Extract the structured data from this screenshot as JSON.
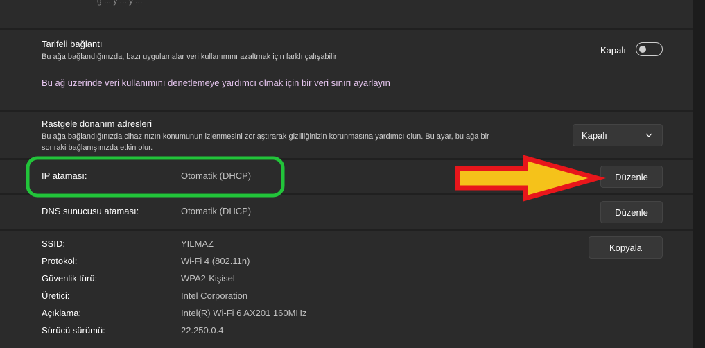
{
  "top_partial": {
    "text": "g ... y ... y ..."
  },
  "metered": {
    "title": "Tarifeli bağlantı",
    "description": "Bu ağa bağlandığınızda, bazı uygulamalar veri kullanımını azaltmak için farklı çalışabilir",
    "toggle_label": "Kapalı",
    "toggle_state": "off",
    "link": "Bu ağ üzerinde veri kullanımını denetlemeye yardımcı olmak için bir veri sınırı ayarlayın"
  },
  "random_hw": {
    "title": "Rastgele donanım adresleri",
    "description_line1": "Bu ağa bağlandığınızda cihazınızın konumunun izlenmesini zorlaştırarak gizliliğinizin korunmasına yardımcı olun. Bu ayar, bu ağa bir",
    "description_line2": "sonraki bağlanışınızda etkin olur.",
    "dropdown_value": "Kapalı"
  },
  "ip": {
    "label": "IP ataması:",
    "value": "Otomatik (DHCP)",
    "button": "Düzenle"
  },
  "dns": {
    "label": "DNS sunucusu ataması:",
    "value": "Otomatik (DHCP)",
    "button": "Düzenle"
  },
  "properties": {
    "copy_button": "Kopyala",
    "rows": [
      {
        "label": "SSID:",
        "value": "YILMAZ"
      },
      {
        "label": "Protokol:",
        "value": "Wi-Fi 4 (802.11n)"
      },
      {
        "label": "Güvenlik türü:",
        "value": "WPA2-Kişisel"
      },
      {
        "label": "Üretici:",
        "value": "Intel Corporation"
      },
      {
        "label": "Açıklama:",
        "value": "Intel(R) Wi-Fi 6 AX201 160MHz"
      },
      {
        "label": "Sürücü sürümü:",
        "value": "22.250.0.4"
      }
    ]
  },
  "annotations": {
    "highlight_color": "#22c43a",
    "arrow_outline_color": "#e8161b",
    "arrow_fill_color": "#f5c21a"
  },
  "icons": {
    "dropdown": "chevron-down-icon"
  }
}
